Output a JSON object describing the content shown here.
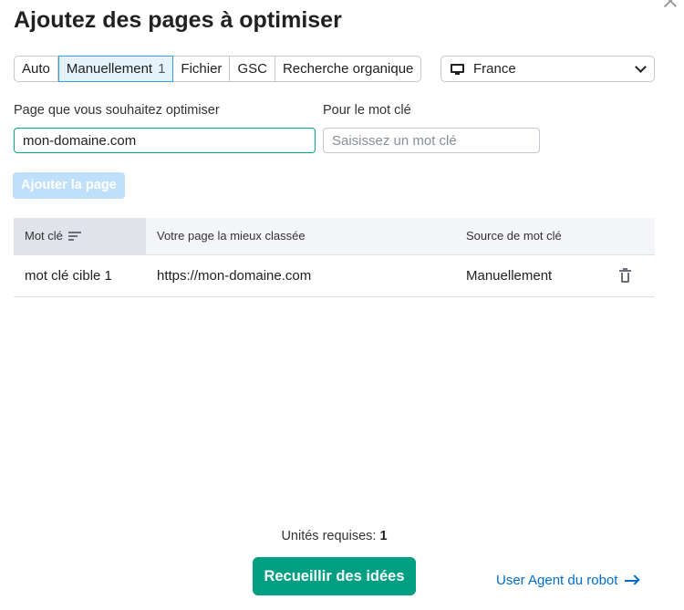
{
  "dialog": {
    "title": "Ajoutez des pages à optimiser"
  },
  "source_tabs": [
    {
      "label": "Auto",
      "active": false
    },
    {
      "label": "Manuellement",
      "count": "1",
      "active": true
    },
    {
      "label": "Fichier",
      "active": false
    },
    {
      "label": "GSC",
      "active": false
    },
    {
      "label": "Recherche organique",
      "active": false
    }
  ],
  "country_select": {
    "value": "France",
    "icon": "monitor-icon"
  },
  "form": {
    "page_label": "Page que vous souhaitez optimiser",
    "page_value": "mon-domaine.com",
    "keyword_label": "Pour le mot clé",
    "keyword_placeholder": "Saisissez un mot clé",
    "add_button": "Ajouter la page"
  },
  "table": {
    "headers": [
      "Mot clé",
      "Votre page la mieux classée",
      "Source de mot clé"
    ],
    "rows": [
      {
        "keyword": "mot clé cible 1",
        "page": "https://mon-domaine.com",
        "source": "Manuellement"
      }
    ]
  },
  "footer": {
    "units_label": "Unités requises:",
    "units_value": "1",
    "primary_button": "Recueillir des idées",
    "link": "User Agent du robot"
  },
  "colors": {
    "primary": "#009f81",
    "link": "#006dca",
    "active_tab_bg": "#e4f2fb",
    "disabled_button": "#bfe0fb"
  }
}
